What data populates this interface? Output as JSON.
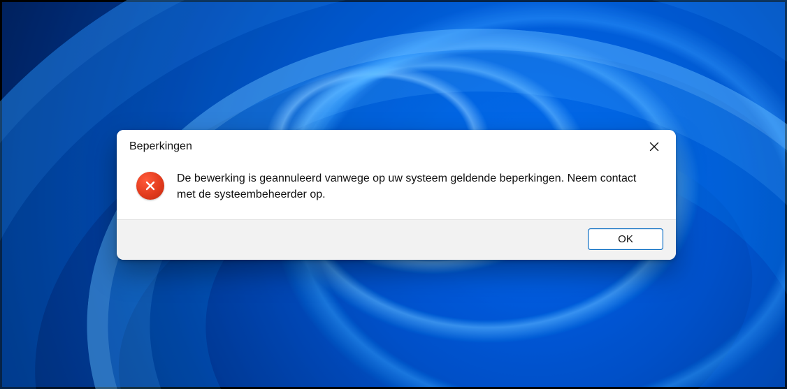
{
  "dialog": {
    "title": "Beperkingen",
    "message": "De bewerking is geannuleerd vanwege op uw systeem geldende beperkingen. Neem contact met de systeembeheerder op.",
    "ok_label": "OK"
  }
}
